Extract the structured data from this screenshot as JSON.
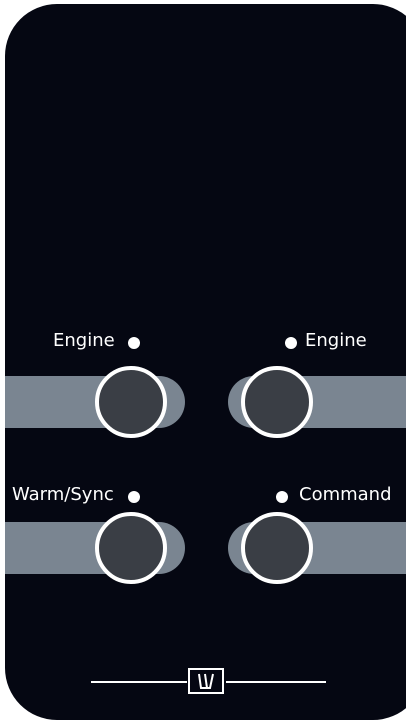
{
  "panel": {
    "background": "#050712",
    "bar_color": "#7a8591",
    "knob_color": "#3a3e45"
  },
  "buttons": {
    "top_left": {
      "label": "Engine"
    },
    "top_right": {
      "label": "Engine"
    },
    "bottom_left": {
      "label": "Warm/Sync"
    },
    "bottom_right": {
      "label": "Command"
    }
  },
  "logo": {
    "icon": "brand-logo-icon"
  }
}
